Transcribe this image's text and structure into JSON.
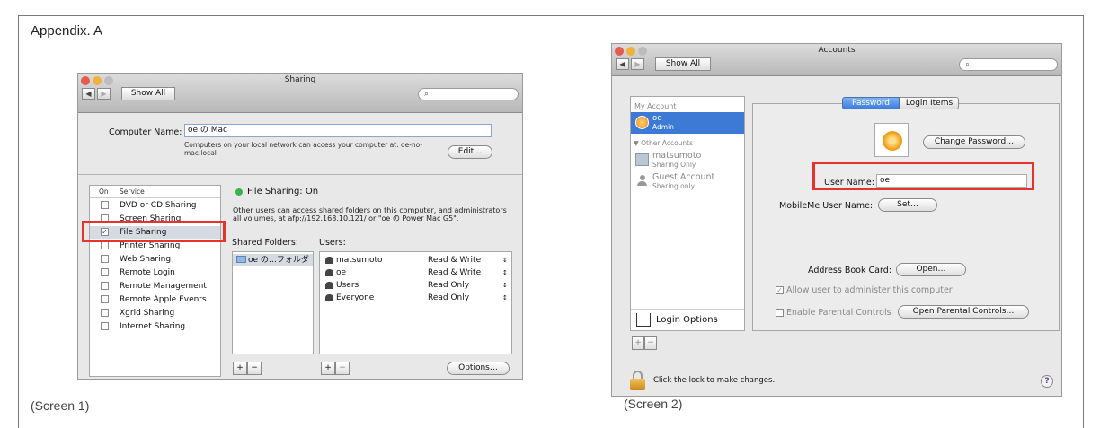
{
  "appendix": "Appendix. A",
  "captions": {
    "s1": "(Screen 1)",
    "s2": "(Screen 2)"
  },
  "s1": {
    "title": "Sharing",
    "show_all": "Show All",
    "search_glyph": "⌕",
    "computer_name_label": "Computer Name:",
    "computer_name": "oe の Mac",
    "cn_desc1": "Computers on your local network can access your computer at: oe-no-",
    "cn_desc2": "mac.local",
    "edit": "Edit…",
    "col_on": "On",
    "col_service": "Service",
    "services": [
      {
        "name": "DVD or CD Sharing",
        "on": false
      },
      {
        "name": "Screen Sharing",
        "on": false
      },
      {
        "name": "File Sharing",
        "on": true
      },
      {
        "name": "Printer Sharing",
        "on": false
      },
      {
        "name": "Web Sharing",
        "on": false
      },
      {
        "name": "Remote Login",
        "on": false
      },
      {
        "name": "Remote Management",
        "on": false
      },
      {
        "name": "Remote Apple Events",
        "on": false
      },
      {
        "name": "Xgrid Sharing",
        "on": false
      },
      {
        "name": "Internet Sharing",
        "on": false
      }
    ],
    "status": "File Sharing: On",
    "desc1": "Other users can access shared folders on this computer, and administrators",
    "desc2": "all volumes, at afp://192.168.10.121/ or \"oe の Power Mac G5\".",
    "shared_folders": "Shared Folders:",
    "users_label": "Users:",
    "folder": "oe の…フォルダ",
    "users": [
      {
        "name": "matsumoto",
        "perm": "Read & Write"
      },
      {
        "name": "oe",
        "perm": "Read & Write"
      },
      {
        "name": "Users",
        "perm": "Read Only"
      },
      {
        "name": "Everyone",
        "perm": "Read Only"
      }
    ],
    "plus": "+",
    "minus": "−",
    "options": "Options…"
  },
  "s2": {
    "title": "Accounts",
    "show_all": "Show All",
    "search_glyph": "⌕",
    "my_account": "My Account",
    "me_name": "oe",
    "me_role": "Admin",
    "other_accounts": "▼ Other Accounts",
    "others": [
      {
        "name": "matsumoto",
        "role": "Sharing Only"
      },
      {
        "name": "Guest Account",
        "role": "Sharing only"
      }
    ],
    "login_options": "Login Options",
    "tab_password": "Password",
    "tab_login": "Login Items",
    "change_password": "Change Password…",
    "user_name_label": "User Name:",
    "user_name": "oe",
    "mobileme_label": "MobileMe User Name:",
    "set": "Set…",
    "address_label": "Address Book Card:",
    "open": "Open…",
    "allow_admin": "Allow user to administer this computer",
    "parental": "Enable Parental Controls",
    "open_parental": "Open Parental Controls…",
    "lock_text": "Click the lock to make changes.",
    "help": "?",
    "plus": "+",
    "minus": "−"
  }
}
